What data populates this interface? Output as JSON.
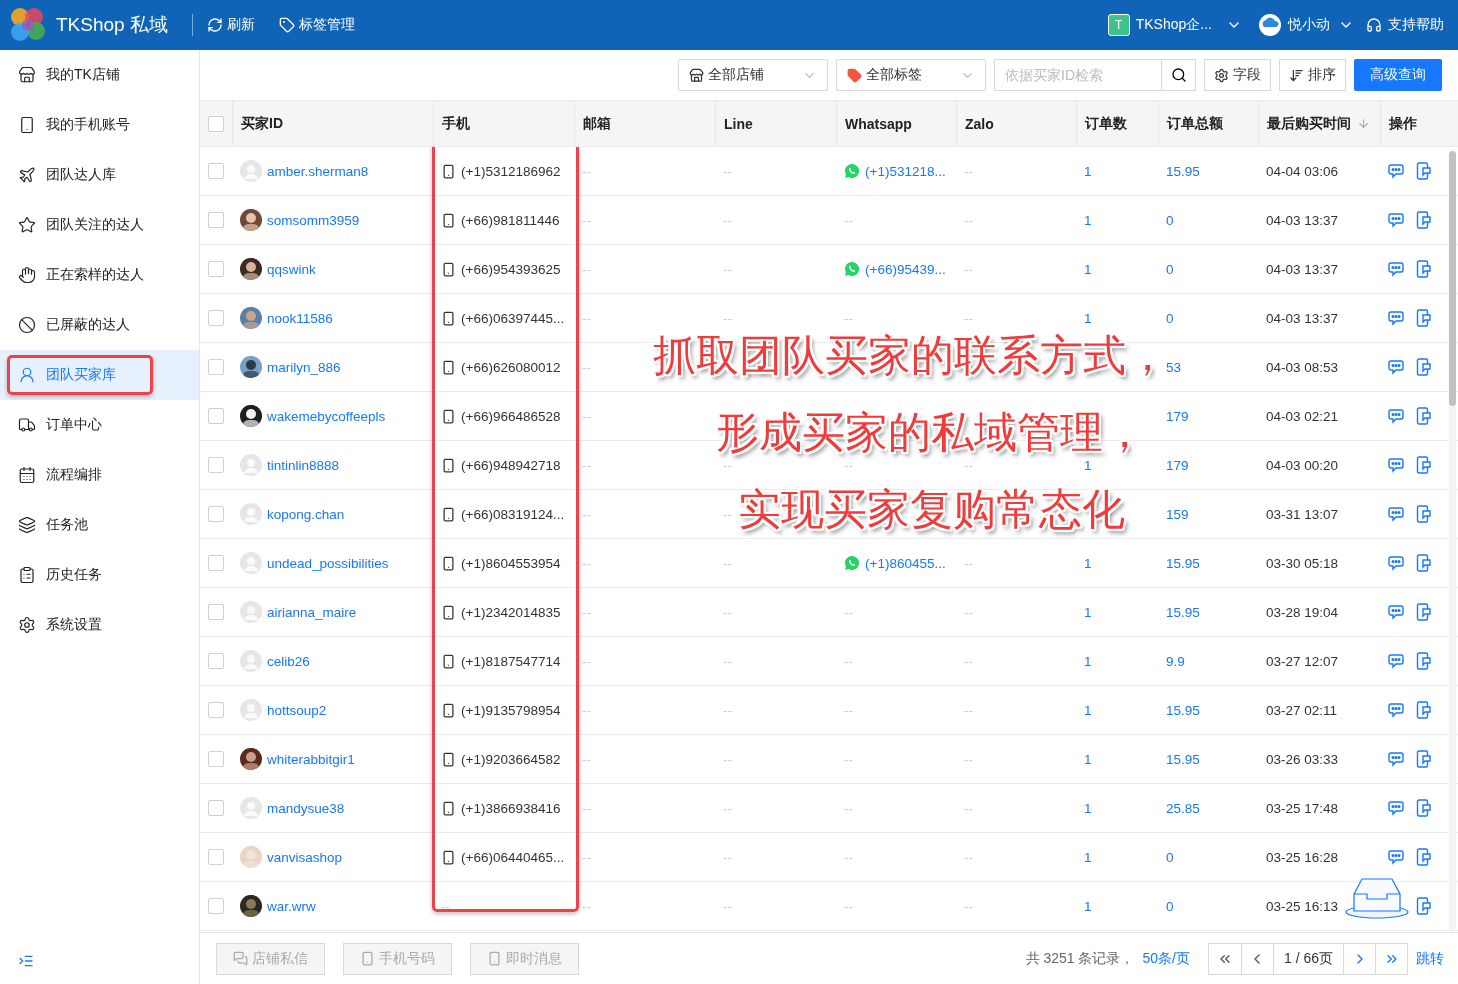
{
  "header": {
    "brand": "TKShop 私域",
    "actions": [
      {
        "kind": "refresh",
        "label": "刷新"
      },
      {
        "kind": "tag",
        "label": "标签管理"
      }
    ],
    "team": {
      "badge": "T",
      "name": "TKShop企..."
    },
    "user": {
      "name": "悦小动"
    },
    "help": "支持帮助"
  },
  "sidebar": {
    "items": [
      {
        "kind": "shop",
        "label": "我的TK店铺",
        "selected": false
      },
      {
        "kind": "phone",
        "label": "我的手机账号",
        "selected": false
      },
      {
        "kind": "people",
        "label": "团队达人库",
        "selected": false
      },
      {
        "kind": "star",
        "label": "团队关注的达人",
        "selected": false
      },
      {
        "kind": "hand",
        "label": "正在索样的达人",
        "selected": false
      },
      {
        "kind": "ban",
        "label": "已屏蔽的达人",
        "selected": false
      },
      {
        "kind": "user",
        "label": "团队买家库",
        "selected": true
      },
      {
        "kind": "truck",
        "label": "订单中心",
        "selected": false
      },
      {
        "kind": "calendar",
        "label": "流程编排",
        "selected": false
      },
      {
        "kind": "layers",
        "label": "任务池",
        "selected": false
      },
      {
        "kind": "history",
        "label": "历史任务",
        "selected": false
      },
      {
        "kind": "settings",
        "label": "系统设置",
        "selected": false
      }
    ]
  },
  "toolbar": {
    "shop_select": "全部店铺",
    "tag_select": "全部标签",
    "search": {
      "placeholder": "依据买家ID检索"
    },
    "fields_button": "字段",
    "sort_button": "排序",
    "query_button": "高级查询"
  },
  "table": {
    "header_checked": false,
    "columns": [
      "买家ID",
      "手机",
      "邮箱",
      "Line",
      "Whatsapp",
      "Zalo",
      "订单数",
      "订单总额",
      "最后购买时间",
      "操作"
    ],
    "rows": [
      {
        "checked": false,
        "kind": "default",
        "buyer_id": "amber.sherman8",
        "phone": {
          "kind": "number",
          "text": "(+1)5312186962"
        },
        "email": "--",
        "line": "--",
        "whatsapp": {
          "kind": "number",
          "text": "(+1)531218..."
        },
        "zalo": "--",
        "order_count": "1",
        "order_total": "15.95",
        "last_purchase": "04-04 03:06"
      },
      {
        "checked": false,
        "buyer_id": "somsomm3959",
        "phone": {
          "kind": "number",
          "text": "(+66)981811446"
        },
        "email": "--",
        "line": "--",
        "whatsapp": {
          "kind": "none",
          "text": "--"
        },
        "zalo": "--",
        "order_count": "1",
        "order_total": "0",
        "last_purchase": "04-03 13:37"
      },
      {
        "checked": false,
        "buyer_id": "qqswink",
        "phone": {
          "kind": "number",
          "text": "(+66)954393625"
        },
        "email": "--",
        "line": "--",
        "whatsapp": {
          "kind": "number",
          "text": "(+66)95439..."
        },
        "zalo": "--",
        "order_count": "1",
        "order_total": "0",
        "last_purchase": "04-03 13:37"
      },
      {
        "checked": false,
        "buyer_id": "nook11586",
        "phone": {
          "kind": "number",
          "text": "(+66)06397445..."
        },
        "email": "--",
        "line": "--",
        "whatsapp": {
          "kind": "none",
          "text": "--"
        },
        "zalo": "--",
        "order_count": "1",
        "order_total": "0",
        "last_purchase": "04-03 13:37"
      },
      {
        "checked": false,
        "buyer_id": "marilyn_886",
        "phone": {
          "kind": "number",
          "text": "(+66)626080012"
        },
        "email": "--",
        "order_total": "53",
        "last_purchase": "04-03 08:53"
      },
      {
        "checked": false,
        "buyer_id": "wakemebycoffeepls",
        "phone": {
          "kind": "number",
          "text": "(+66)966486528"
        },
        "email": "--",
        "order_total": "179",
        "last_purchase": "04-03 02:21"
      },
      {
        "checked": false,
        "kind": "default",
        "buyer_id": "tintinlin8888",
        "phone": {
          "kind": "number",
          "text": "(+66)948942718"
        },
        "email": "--",
        "line": "--",
        "whatsapp": {
          "kind": "none",
          "text": "--"
        },
        "zalo": "--",
        "order_count": "1",
        "order_total": "179",
        "last_purchase": "04-03 00:20"
      },
      {
        "checked": false,
        "kind": "default",
        "buyer_id": "kopong.chan",
        "phone": {
          "kind": "number",
          "text": "(+66)08319124..."
        },
        "email": "--",
        "line": "--",
        "order_total": "159",
        "last_purchase": "03-31 13:07"
      },
      {
        "checked": false,
        "kind": "default",
        "buyer_id": "undead_possibilities",
        "phone": {
          "kind": "number",
          "text": "(+1)8604553954"
        },
        "email": "--",
        "line": "--",
        "whatsapp": {
          "kind": "number",
          "text": "(+1)860455..."
        },
        "zalo": "--",
        "order_count": "1",
        "order_total": "15.95",
        "last_purchase": "03-30 05:18"
      },
      {
        "checked": false,
        "kind": "default",
        "buyer_id": "airianna_maire",
        "phone": {
          "kind": "number",
          "text": "(+1)2342014835"
        },
        "email": "--",
        "line": "--",
        "whatsapp": {
          "kind": "none",
          "text": "--"
        },
        "zalo": "--",
        "order_count": "1",
        "order_total": "15.95",
        "last_purchase": "03-28 19:04"
      },
      {
        "checked": false,
        "kind": "default",
        "buyer_id": "celib26",
        "phone": {
          "kind": "number",
          "text": "(+1)8187547714"
        },
        "email": "--",
        "line": "--",
        "whatsapp": {
          "kind": "none",
          "text": "--"
        },
        "zalo": "--",
        "order_count": "1",
        "order_total": "9.9",
        "last_purchase": "03-27 12:07"
      },
      {
        "checked": false,
        "kind": "default",
        "buyer_id": "hottsoup2",
        "phone": {
          "kind": "number",
          "text": "(+1)9135798954"
        },
        "email": "--",
        "line": "--",
        "whatsapp": {
          "kind": "none",
          "text": "--"
        },
        "zalo": "--",
        "order_count": "1",
        "order_total": "15.95",
        "last_purchase": "03-27 02:11"
      },
      {
        "checked": false,
        "buyer_id": "whiterabbitgir1",
        "phone": {
          "kind": "number",
          "text": "(+1)9203664582"
        },
        "email": "--",
        "line": "--",
        "whatsapp": {
          "kind": "none",
          "text": "--"
        },
        "zalo": "--",
        "order_count": "1",
        "order_total": "15.95",
        "last_purchase": "03-26 03:33"
      },
      {
        "checked": false,
        "kind": "default",
        "buyer_id": "mandysue38",
        "phone": {
          "kind": "number",
          "text": "(+1)3866938416"
        },
        "email": "--",
        "line": "--",
        "whatsapp": {
          "kind": "none",
          "text": "--"
        },
        "zalo": "--",
        "order_count": "1",
        "order_total": "25.85",
        "last_purchase": "03-25 17:48"
      },
      {
        "checked": false,
        "buyer_id": "vanvisashop",
        "phone": {
          "kind": "number",
          "text": "(+66)06440465..."
        },
        "email": "--",
        "line": "--",
        "whatsapp": {
          "kind": "none",
          "text": "--"
        },
        "zalo": "--",
        "order_count": "1",
        "order_total": "0",
        "last_purchase": "03-25 16:28"
      },
      {
        "checked": false,
        "buyer_id": "war.wrw",
        "phone": {
          "kind": "none",
          "text": "--"
        },
        "email": "--",
        "line": "--",
        "whatsapp": {
          "kind": "none",
          "text": "--"
        },
        "zalo": "--",
        "order_count": "1",
        "order_total": "0",
        "last_purchase": "03-25 16:13"
      }
    ]
  },
  "caption": [
    "抓取团队买家的联系方式，",
    "形成买家的私域管理，",
    "实现买家复购常态化"
  ],
  "footer": {
    "buttons": [
      {
        "kind": "chat",
        "label": "店铺私信",
        "disabled": true
      },
      {
        "kind": "phone",
        "label": "手机号码",
        "disabled": true
      },
      {
        "kind": "message",
        "label": "即时消息",
        "disabled": true
      }
    ],
    "total": "共 3251 条记录，",
    "page_size": "50条/页",
    "page": "1 / 66页",
    "jump": "跳转"
  }
}
